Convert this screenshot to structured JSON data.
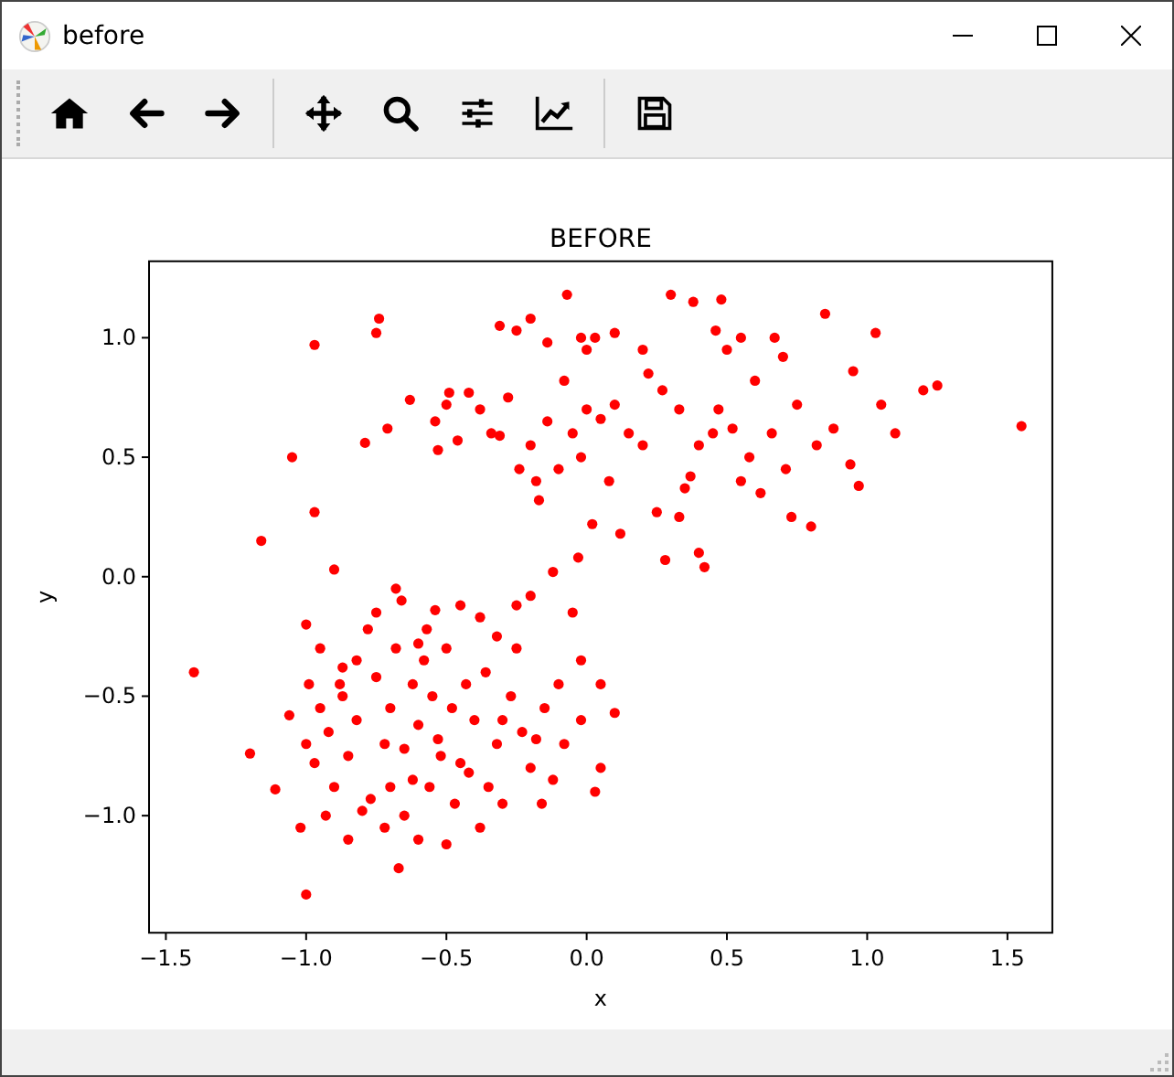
{
  "window": {
    "title": "before"
  },
  "figure": {
    "chart_data": {
      "type": "scatter",
      "title": "BEFORE",
      "xlabel": "x",
      "ylabel": "y",
      "xlim": [
        -1.56,
        1.66
      ],
      "ylim": [
        -1.49,
        1.32
      ],
      "xticks": [
        {
          "value": -1.5,
          "label": "−1.5"
        },
        {
          "value": -1,
          "label": "−1.0"
        },
        {
          "value": -0.5,
          "label": "−0.5"
        },
        {
          "value": 0,
          "label": "0.0"
        },
        {
          "value": 0.5,
          "label": "0.5"
        },
        {
          "value": 1,
          "label": "1.0"
        },
        {
          "value": 1.5,
          "label": "1.5"
        }
      ],
      "yticks": [
        {
          "value": -1,
          "label": "−1.0"
        },
        {
          "value": -0.5,
          "label": "−0.5"
        },
        {
          "value": 0,
          "label": "0.0"
        },
        {
          "value": 0.5,
          "label": "0.5"
        },
        {
          "value": 1,
          "label": "1.0"
        }
      ],
      "series": [
        {
          "color": "#ff0000",
          "x": [
            -0.97,
            -0.74,
            -0.75,
            -1.05,
            -1.16,
            -0.97,
            -0.71,
            -0.79,
            -0.63,
            -0.54,
            -0.49,
            -0.5,
            -0.42,
            -0.53,
            -0.46,
            -0.38,
            -0.34,
            -0.31,
            -0.31,
            -0.25,
            -0.2,
            -0.14,
            -0.07,
            -0.02,
            0.0,
            0.03,
            0.1,
            0.2,
            0.3,
            0.38,
            0.48,
            0.55,
            0.46,
            0.5,
            0.67,
            0.7,
            0.85,
            1.03,
            0.95,
            1.05,
            1.1,
            1.2,
            1.25,
            1.55,
            0.94,
            0.97,
            0.8,
            0.73,
            0.62,
            0.58,
            0.52,
            0.47,
            0.4,
            0.37,
            0.35,
            0.4,
            0.42,
            0.33,
            0.25,
            0.2,
            0.15,
            0.1,
            0.05,
            0.0,
            -0.02,
            -0.05,
            -0.1,
            -0.14,
            -0.18,
            -0.2,
            -0.24,
            -0.17,
            0.12,
            0.28,
            0.22,
            0.27,
            0.33,
            0.6,
            0.75,
            0.82,
            0.66,
            0.88,
            0.71,
            0.55,
            0.45,
            0.08,
            -0.08,
            -0.28,
            0.02,
            -0.03,
            -1.4,
            -1.2,
            -1.11,
            -1.02,
            -1.0,
            -1.06,
            -0.99,
            -1.0,
            -0.9,
            -0.95,
            -0.87,
            -0.82,
            -0.75,
            -0.68,
            -0.66,
            -0.6,
            -0.57,
            -0.54,
            -0.45,
            -0.38,
            -0.32,
            -0.25,
            -0.2,
            -0.12,
            -0.05,
            -0.02,
            0.05,
            0.1,
            0.05,
            0.03,
            -0.02,
            -0.08,
            -0.12,
            -0.16,
            -0.2,
            -0.23,
            -0.27,
            -0.32,
            -0.35,
            -0.38,
            -0.4,
            -0.43,
            -0.45,
            -0.47,
            -0.5,
            -0.53,
            -0.55,
            -0.58,
            -0.6,
            -0.62,
            -0.65,
            -0.67,
            -0.7,
            -0.72,
            -0.75,
            -0.77,
            -0.8,
            -0.82,
            -0.85,
            -0.87,
            -0.9,
            -0.92,
            -0.95,
            -0.97,
            -1.0,
            -0.85,
            -0.72,
            -0.6,
            -0.48,
            -0.36,
            -0.3,
            -0.15,
            -0.1,
            -0.25,
            -0.62,
            -0.68,
            -0.78,
            -0.5,
            -0.42,
            -0.56,
            -0.65,
            -0.7,
            -0.88,
            -0.93,
            -0.52,
            -0.3,
            -0.18
          ],
          "values": [
            0.97,
            1.08,
            1.02,
            0.5,
            0.15,
            0.27,
            0.62,
            0.56,
            0.74,
            0.65,
            0.77,
            0.72,
            0.77,
            0.53,
            0.57,
            0.7,
            0.6,
            0.59,
            1.05,
            1.03,
            1.08,
            0.98,
            1.18,
            1.0,
            0.95,
            1.0,
            1.02,
            0.95,
            1.18,
            1.15,
            1.16,
            1.0,
            1.03,
            0.95,
            1.0,
            0.92,
            1.1,
            1.02,
            0.86,
            0.72,
            0.6,
            0.78,
            0.8,
            0.63,
            0.47,
            0.38,
            0.21,
            0.25,
            0.35,
            0.5,
            0.62,
            0.7,
            0.55,
            0.42,
            0.37,
            0.1,
            0.04,
            0.25,
            0.27,
            0.55,
            0.6,
            0.72,
            0.66,
            0.7,
            0.5,
            0.6,
            0.45,
            0.65,
            0.4,
            0.55,
            0.45,
            0.32,
            0.18,
            0.07,
            0.85,
            0.78,
            0.7,
            0.82,
            0.72,
            0.55,
            0.6,
            0.62,
            0.45,
            0.4,
            0.6,
            0.4,
            0.82,
            0.75,
            0.22,
            0.08,
            -0.4,
            -0.74,
            -0.89,
            -1.05,
            -1.33,
            -0.58,
            -0.45,
            -0.2,
            0.03,
            -0.3,
            -0.38,
            -0.35,
            -0.15,
            -0.05,
            -0.1,
            -0.28,
            -0.22,
            -0.14,
            -0.12,
            -0.17,
            -0.25,
            -0.12,
            -0.08,
            0.02,
            -0.15,
            -0.35,
            -0.45,
            -0.57,
            -0.8,
            -0.9,
            -0.6,
            -0.7,
            -0.85,
            -0.95,
            -0.8,
            -0.65,
            -0.5,
            -0.7,
            -0.88,
            -1.05,
            -0.6,
            -0.45,
            -0.78,
            -0.95,
            -1.12,
            -0.68,
            -0.5,
            -0.35,
            -0.62,
            -0.85,
            -1.0,
            -1.22,
            -0.55,
            -0.7,
            -0.42,
            -0.93,
            -0.98,
            -0.6,
            -0.75,
            -0.5,
            -0.88,
            -0.65,
            -0.55,
            -0.78,
            -0.7,
            -1.1,
            -1.05,
            -1.1,
            -0.55,
            -0.4,
            -0.95,
            -0.55,
            -0.45,
            -0.3,
            -0.45,
            -0.3,
            -0.22,
            -0.3,
            -0.82,
            -0.88,
            -0.72,
            -0.88,
            -0.45,
            -1.0,
            -0.75,
            -0.6,
            -0.68
          ]
        }
      ]
    }
  }
}
